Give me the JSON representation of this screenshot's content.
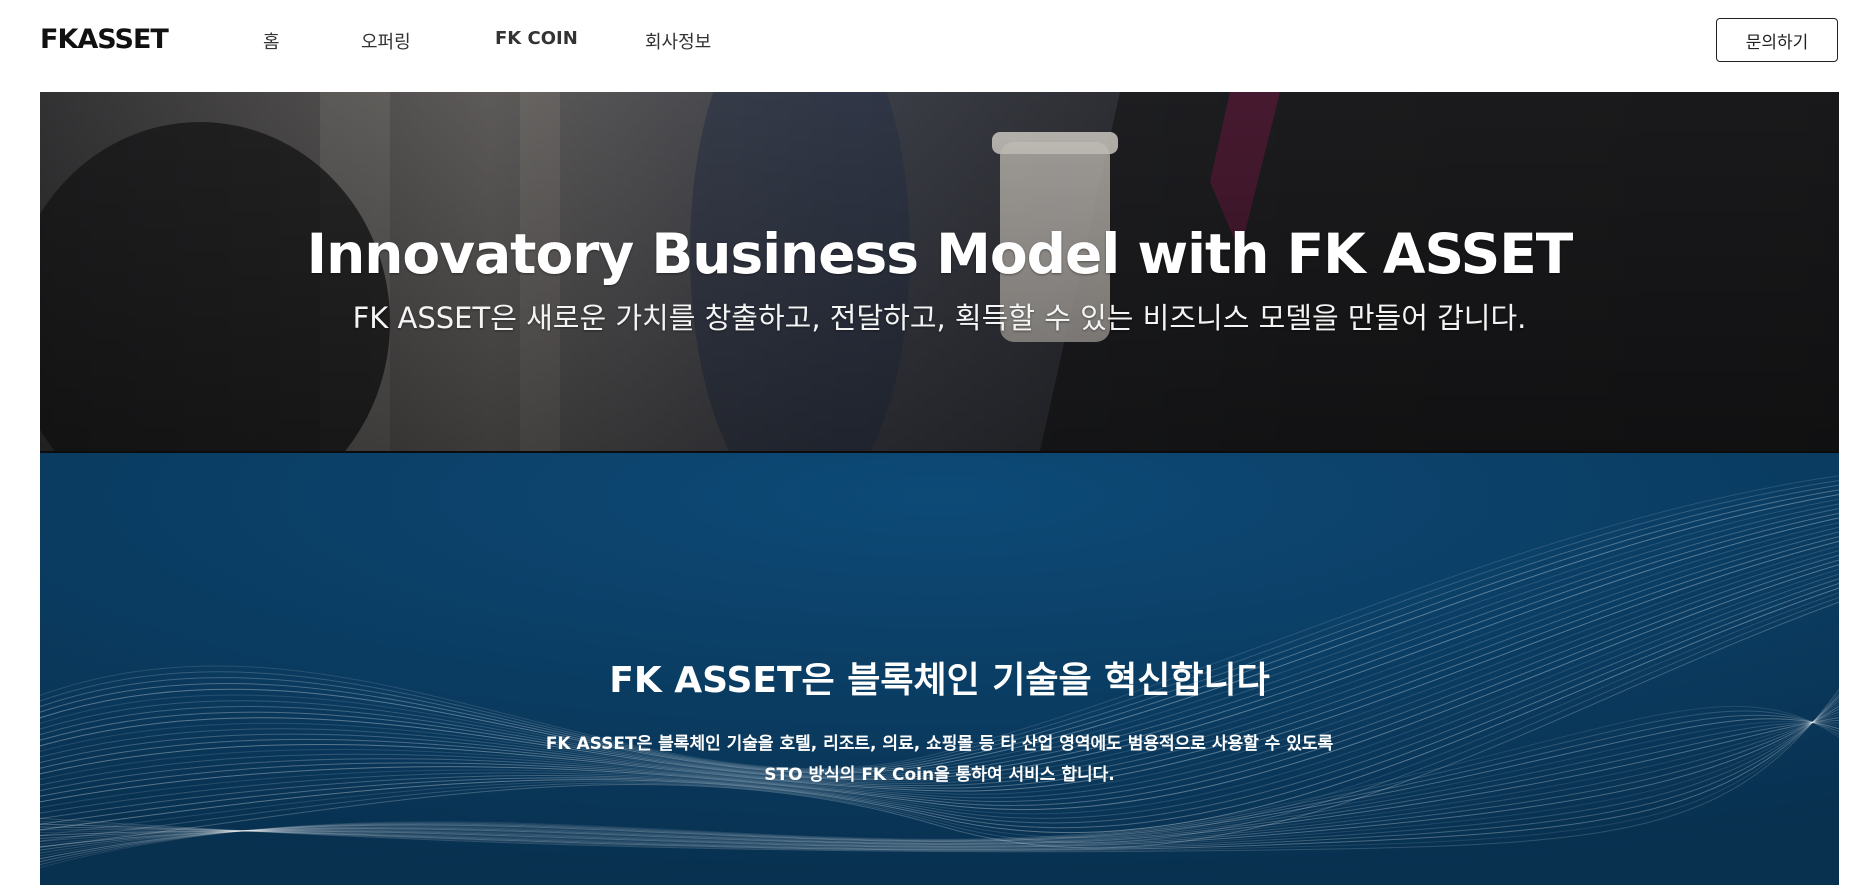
{
  "header": {
    "logo": "FKASSET",
    "nav": [
      {
        "label": "홈"
      },
      {
        "label": "오퍼링"
      },
      {
        "label": "FK COIN"
      },
      {
        "label": "회사정보"
      }
    ],
    "contact_label": "문의하기"
  },
  "hero": {
    "title": "Innovatory Business Model with FK ASSET",
    "subtitle": "FK ASSET은 새로운 가치를 창출하고, 전달하고, 획득할 수 있는 비즈니스 모델을 만들어 갑니다."
  },
  "blockchain": {
    "title": "FK ASSET은 블록체인 기술을 혁신합니다",
    "desc_line1": "FK ASSET은 블록체인 기술을 호텔, 리조트, 의료, 쇼핑몰 등 타 산업 영역에도 범용적으로 사용할 수 있도록",
    "desc_line2": "STO 방식의 FK Coin을 통하여 서비스 합니다."
  },
  "colors": {
    "hero_bg": "#2a2a2c",
    "blue_bg": "#0a3d63",
    "text_white": "#ffffff"
  }
}
